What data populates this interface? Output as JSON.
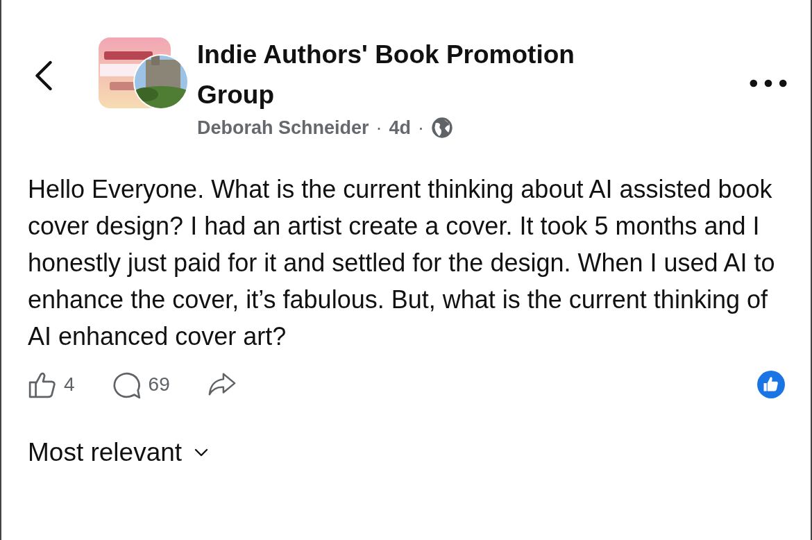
{
  "post": {
    "group_name": "Indie Authors' Book Promotion Group",
    "author": "Deborah Schneider",
    "time": "4d",
    "separator": "·",
    "body": "Hello Everyone. What is the current thinking about AI assisted book cover design? I had an artist create a cover. It took 5 months and I honestly just paid for it and settled for the design. When I used AI to enhance the cover, it’s fabulous. But, what is the current thinking of AI enhanced cover art?",
    "likes": "4",
    "comments": "69"
  },
  "sort": {
    "label": "Most relevant"
  }
}
